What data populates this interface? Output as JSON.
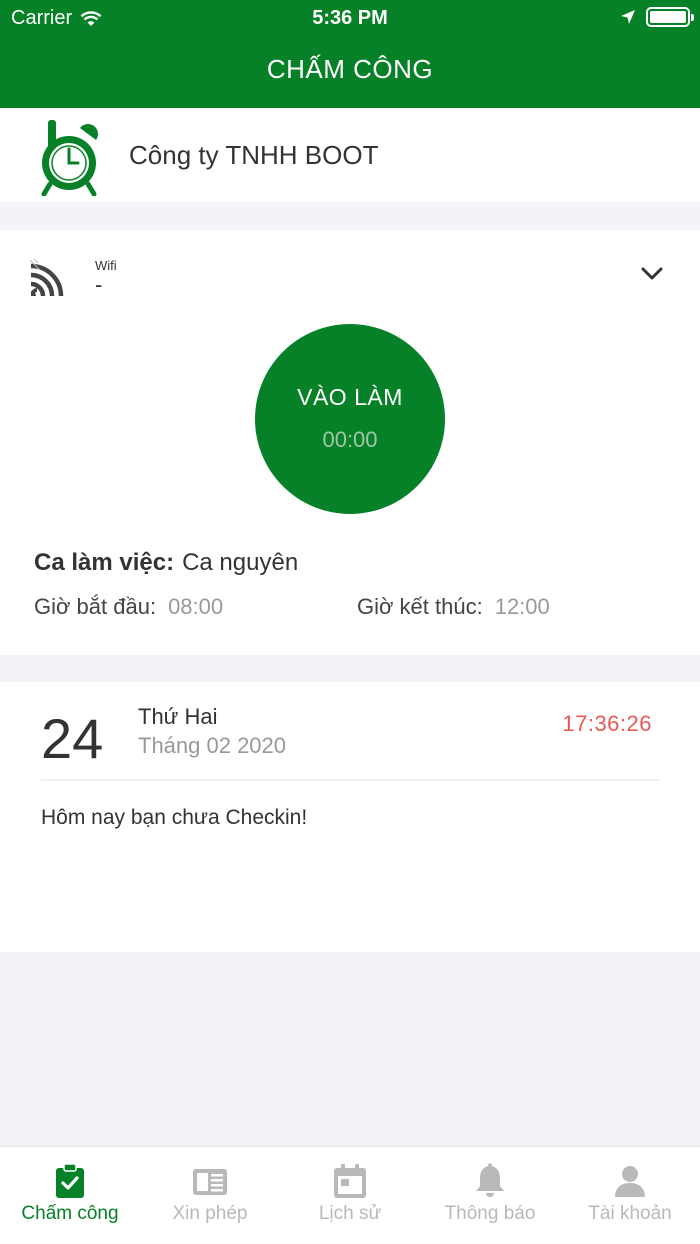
{
  "status_bar": {
    "carrier": "Carrier",
    "time": "5:36 PM"
  },
  "header": {
    "title": "CHẤM CÔNG"
  },
  "company": {
    "name": "Công ty TNHH BOOT",
    "logo_icon": "alarm-clock-logo-icon"
  },
  "connection": {
    "label": "Wifi",
    "value": "-"
  },
  "checkin": {
    "label": "VÀO LÀM",
    "timer": "00:00"
  },
  "shift": {
    "label": "Ca làm việc:",
    "name": "Ca nguyên",
    "start_label": "Giờ bắt đầu:",
    "start_time": "08:00",
    "end_label": "Giờ kết thúc:",
    "end_time": "12:00"
  },
  "day": {
    "number": "24",
    "weekday": "Thứ Hai",
    "month": "Tháng 02 2020",
    "clock": "17:36:26",
    "message": "Hôm nay bạn chưa Checkin!"
  },
  "tabs": [
    {
      "label": "Chấm công",
      "icon": "clipboard-check-icon",
      "active": true
    },
    {
      "label": "Xin phép",
      "icon": "newspaper-icon",
      "active": false
    },
    {
      "label": "Lịch sử",
      "icon": "calendar-icon",
      "active": false
    },
    {
      "label": "Thông báo",
      "icon": "bell-icon",
      "active": false
    },
    {
      "label": "Tài khoản",
      "icon": "user-icon",
      "active": false
    }
  ],
  "colors": {
    "primary": "#068127",
    "clock_red": "#e85a55",
    "inactive": "#b9b9b9"
  }
}
